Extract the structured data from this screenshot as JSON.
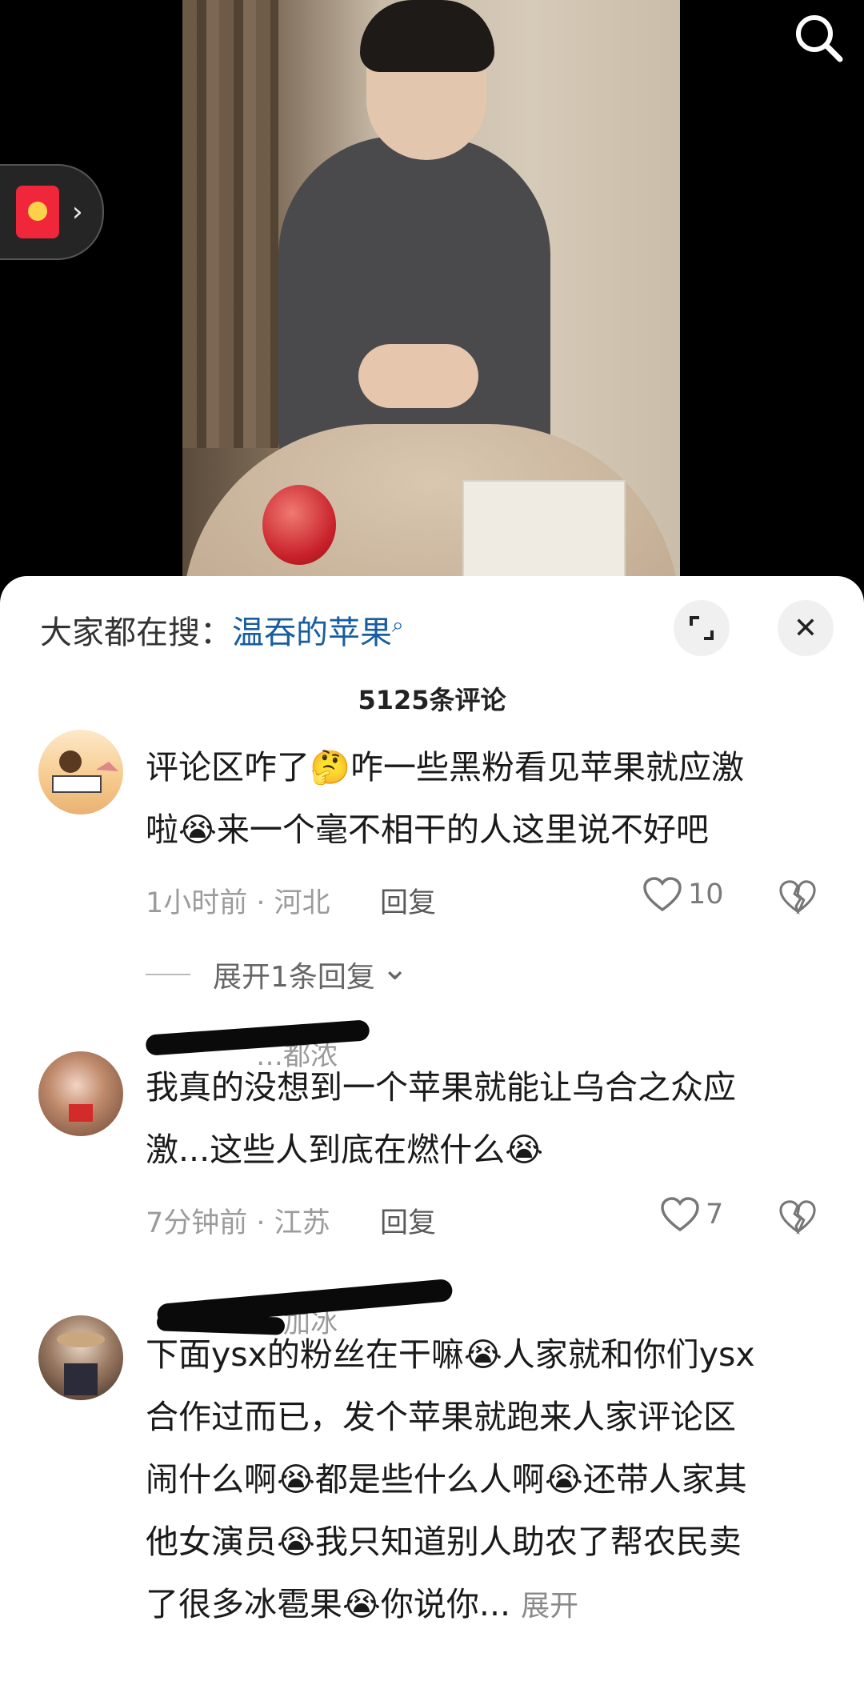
{
  "video": {
    "search_icon": "search-icon"
  },
  "hongbao": {
    "icon": "red-envelope-icon",
    "chevron": "›"
  },
  "sheet": {
    "hot_search_prefix": "大家都在搜：",
    "hot_search_keyword": "温吞的苹果",
    "hot_search_mag": "⌕",
    "expand_icon": "⤢",
    "close_icon": "✕",
    "comment_count_title": "5125条评论"
  },
  "comments": [
    {
      "username": "",
      "text_line1": "评论区咋了🤔咋一些黑粉看见苹果就应激",
      "text_line2": "啦😭来一个毫不相干的人这里说不好吧",
      "meta": "1小时前 · 河北",
      "reply_label": "回复",
      "likes": "10",
      "expand_replies": "展开1条回复",
      "expand_chevron": "⌄"
    },
    {
      "username": "…都浓",
      "text_line1": "我真的没想到一个苹果就能让乌合之众应",
      "text_line2": "激...这些人到底在燃什么😭",
      "meta": "7分钟前 · 江苏",
      "reply_label": "回复",
      "likes": "7"
    },
    {
      "username": "…加冰",
      "text_lines": [
        "下面ysx的粉丝在干嘛😭人家就和你们ysx",
        "合作过而已，发个苹果就跑来人家评论区",
        "闹什么啊😭都是些什么人啊😭还带人家其",
        "他女演员😭我只知道别人助农了帮农民卖",
        "了很多冰雹果😭你说你..."
      ],
      "more_label": "展开"
    }
  ]
}
